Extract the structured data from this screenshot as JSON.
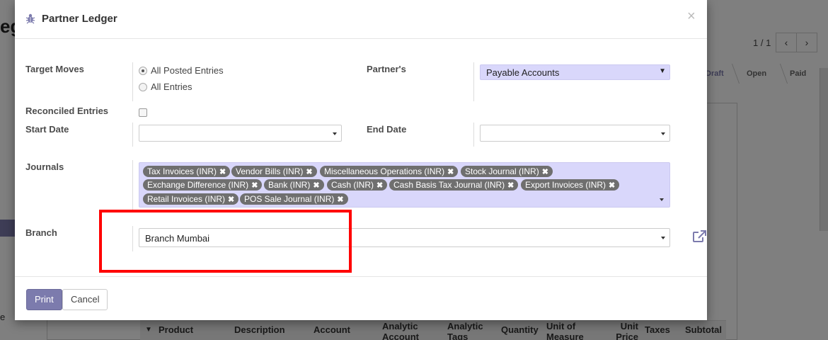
{
  "background": {
    "title_fragment": "eg",
    "pager": "1 / 1",
    "pager_prev": "‹",
    "pager_next": "›",
    "statuses": [
      "Draft",
      "Open",
      "Paid"
    ],
    "left_letter": "e",
    "table_columns": [
      "Product",
      "Description",
      "Account",
      "Analytic Account",
      "Analytic Tags",
      "Quantity",
      "Unit of Measure",
      "Unit Price",
      "Taxes",
      "Subtotal"
    ]
  },
  "dialog": {
    "title": "Partner Ledger",
    "close_glyph": "×",
    "target_moves": {
      "label": "Target Moves",
      "options": [
        "All Posted Entries",
        "All Entries"
      ],
      "selected": "All Posted Entries"
    },
    "partners": {
      "label": "Partner's",
      "value": "Payable Accounts"
    },
    "reconciled": {
      "label": "Reconciled Entries",
      "checked": false
    },
    "start_date": {
      "label": "Start Date",
      "value": ""
    },
    "end_date": {
      "label": "End Date",
      "value": ""
    },
    "journals": {
      "label": "Journals",
      "tags": [
        "Tax Invoices (INR)",
        "Vendor Bills (INR)",
        "Miscellaneous Operations (INR)",
        "Stock Journal (INR)",
        "Exchange Difference (INR)",
        "Bank (INR)",
        "Cash (INR)",
        "Cash Basis Tax Journal (INR)",
        "Export Invoices (INR)",
        "Retail Invoices (INR)",
        "POS Sale Journal (INR)"
      ]
    },
    "branch": {
      "label": "Branch",
      "value": "Branch Mumbai"
    },
    "footer": {
      "print_label": "Print",
      "cancel_label": "Cancel"
    }
  },
  "colors": {
    "brand": "#7c7bad",
    "tag_field_bg": "#d9d7fb",
    "highlight": "#ff0000"
  }
}
